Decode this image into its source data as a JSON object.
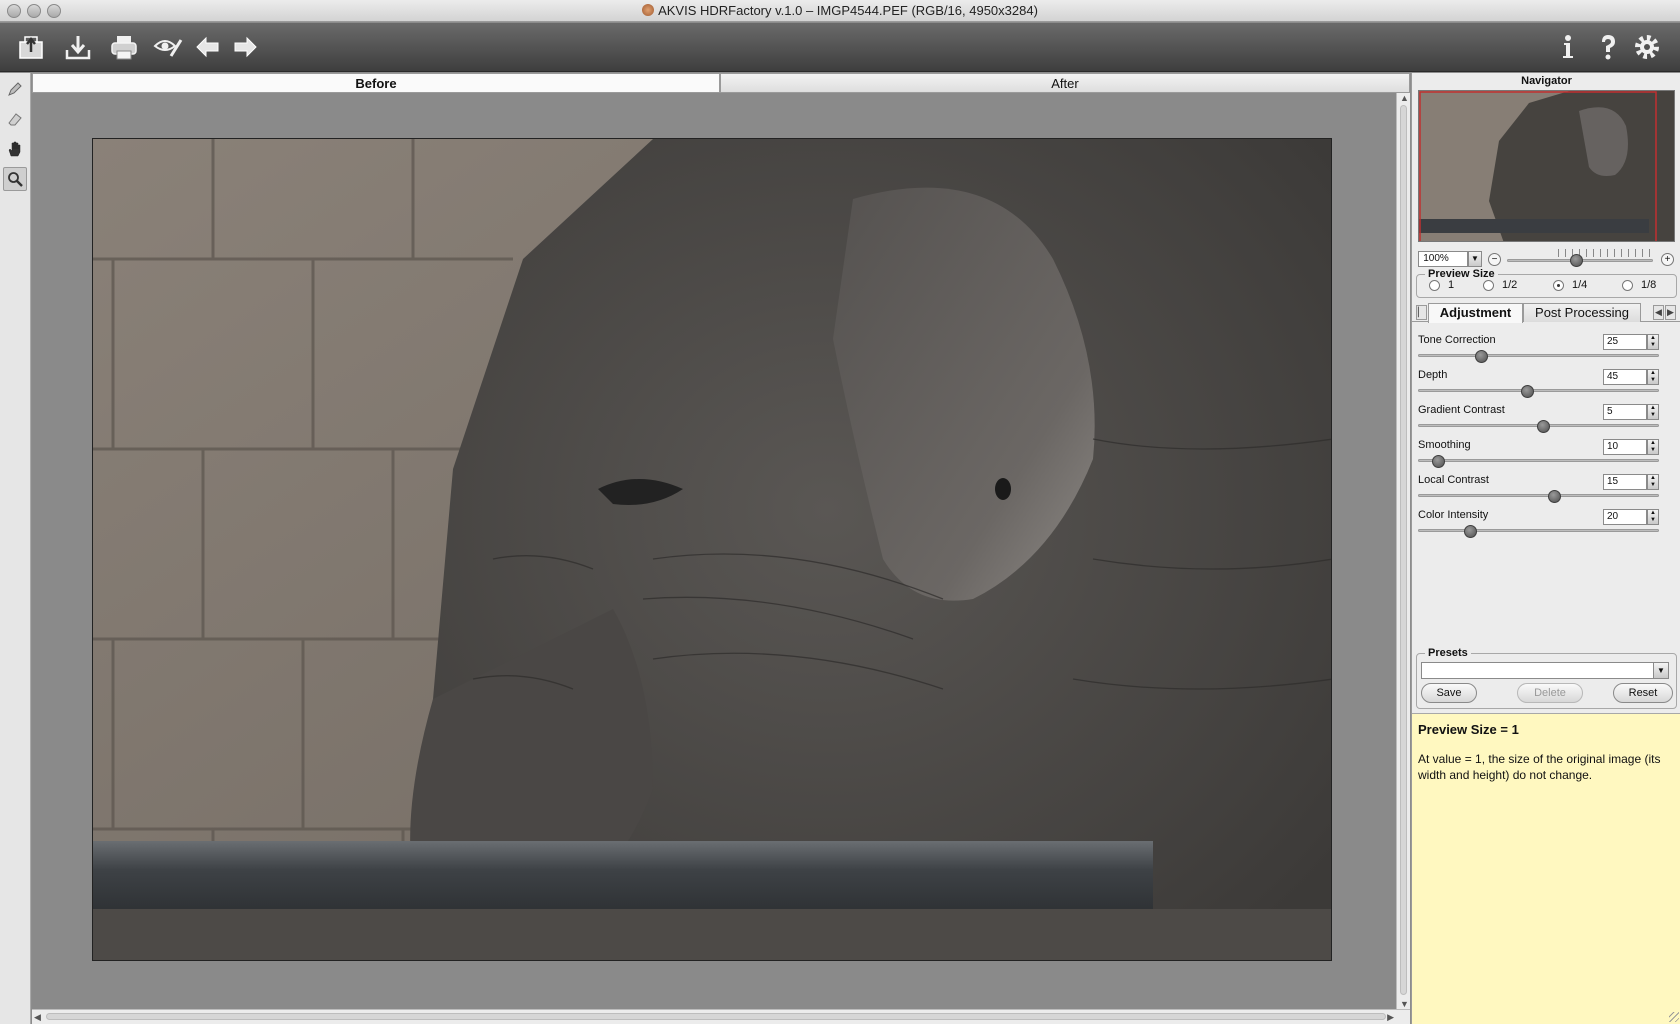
{
  "window": {
    "title": "AKVIS HDRFactory v.1.0 – IMGP4544.PEF (RGB/16, 4950x3284)"
  },
  "toolbar": {
    "left_icons": [
      "open-icon",
      "save-icon",
      "print-icon",
      "preview-eye-icon",
      "undo-icon",
      "redo-icon"
    ],
    "right_icons": [
      "info-icon",
      "help-icon",
      "settings-gear-icon"
    ]
  },
  "tools": [
    "pencil-icon",
    "eraser-icon",
    "hand-icon",
    "zoom-icon"
  ],
  "view_tabs": {
    "before": "Before",
    "after": "After"
  },
  "navigator": {
    "title": "Navigator",
    "zoom_value": "100%",
    "zoom_level_fraction": 0.47
  },
  "preview_size": {
    "label": "Preview Size",
    "options": [
      "1",
      "1/2",
      "1/4",
      "1/8"
    ],
    "selected": "1/4"
  },
  "panel_tabs": {
    "adjustment": "Adjustment",
    "post_processing": "Post Processing"
  },
  "parameters": [
    {
      "label": "Tone Correction",
      "value": "25",
      "fraction": 0.25
    },
    {
      "label": "Depth",
      "value": "45",
      "fraction": 0.45
    },
    {
      "label": "Gradient Contrast",
      "value": "5",
      "fraction": 0.52
    },
    {
      "label": "Smoothing",
      "value": "10",
      "fraction": 0.06
    },
    {
      "label": "Local Contrast",
      "value": "15",
      "fraction": 0.57
    },
    {
      "label": "Color Intensity",
      "value": "20",
      "fraction": 0.2
    }
  ],
  "presets": {
    "label": "Presets",
    "value": "",
    "save": "Save",
    "delete": "Delete",
    "reset": "Reset"
  },
  "help": {
    "title": "Preview Size = 1",
    "text": "At value = 1, the size of the original image (its width and height) do not change."
  },
  "colors": {
    "toolbar_top": "#6a6a6a",
    "toolbar_bottom": "#3e3e3e",
    "help_bg": "#fff8c0",
    "canvas_bg": "#8a8a8a"
  }
}
